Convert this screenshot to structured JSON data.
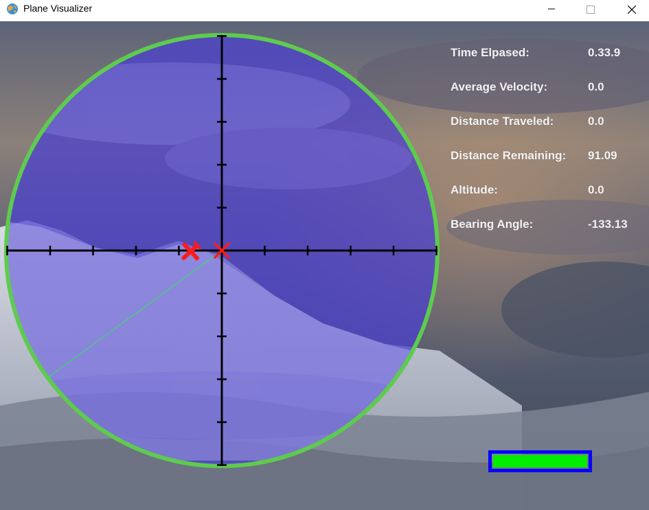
{
  "window": {
    "title": "Plane Visualizer",
    "icon": "globe-icon",
    "controls": [
      "minimize-icon",
      "maximize-icon",
      "close-icon"
    ]
  },
  "stats": {
    "time_elapsed": {
      "label": "Time Elpased:",
      "value": "0.33.9"
    },
    "average_velocity": {
      "label": "Average Velocity:",
      "value": "0.0"
    },
    "distance_traveled": {
      "label": "Distance Traveled:",
      "value": "0.0"
    },
    "distance_remaining": {
      "label": "Distance Remaining:",
      "value": "91.09"
    },
    "altitude": {
      "label": "Altitude:",
      "value": "0.0"
    },
    "bearing_angle": {
      "label": "Bearing Angle:",
      "value": "-133.13"
    }
  },
  "radar": {
    "ring_color": "#5ecb4e",
    "fill_color": "#4a3fd0",
    "crosshair_color": "#000000",
    "target_marker_color": "#ff1a1a",
    "plane_color": "#ff1a1a",
    "path_color": "#2ee85a",
    "plane_icon": "airplane-icon",
    "target_icon": "x-mark-icon"
  },
  "progress": {
    "fill_fraction": 1.0,
    "fill_color": "#00ee00",
    "border_color": "#0a00ff"
  }
}
